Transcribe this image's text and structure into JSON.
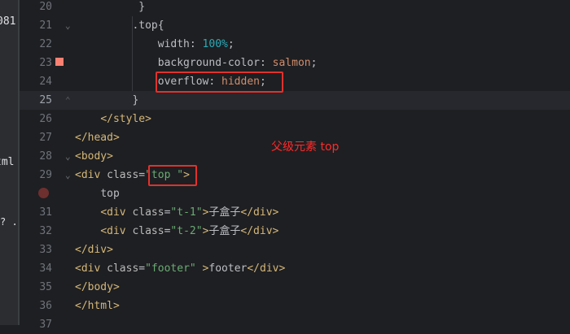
{
  "left_panel": {
    "fragments": [
      "081",
      "tml",
      "? .h"
    ]
  },
  "line_numbers": [
    "20",
    "21",
    "22",
    "23",
    "24",
    "25",
    "26",
    "27",
    "28",
    "29",
    "30",
    "31",
    "32",
    "33",
    "34",
    "35",
    "36",
    "37"
  ],
  "code": {
    "l20": {
      "brace": "}"
    },
    "l21": {
      "selector": ".top",
      "brace": "{"
    },
    "l22": {
      "prop": "width",
      "colon": ": ",
      "num": "100%",
      "semi": ";"
    },
    "l23": {
      "prop": "background-color",
      "colon": ": ",
      "val": "salmon",
      "semi": ";"
    },
    "l24": {
      "prop": "overflow",
      "colon": ": ",
      "val": "hidden",
      "semi": ";"
    },
    "l25": {
      "brace": "}"
    },
    "l26": {
      "tag": "</style>"
    },
    "l27": {
      "tag": "</head>"
    },
    "l28": {
      "tag": "<body>"
    },
    "l29": {
      "tag_open": "<div ",
      "attr": "class",
      "eq": "=",
      "str": "\"top \"",
      "tag_close": ">"
    },
    "l30": {
      "text": "top"
    },
    "l31": {
      "tag_open": "<div ",
      "attr": "class",
      "eq": "=",
      "str": "\"t-1\"",
      "tag_mid": ">",
      "text": "子盒子",
      "tag_close": "</div>"
    },
    "l32": {
      "tag_open": "<div ",
      "attr": "class",
      "eq": "=",
      "str": "\"t-2\"",
      "tag_mid": ">",
      "text": "子盒子",
      "tag_close": "</div>"
    },
    "l33": {
      "tag": "</div>"
    },
    "l34": {
      "tag_open": "<div ",
      "attr": "class",
      "eq": "=",
      "str": "\"footer\"",
      "tag_mid": " >",
      "text": "footer",
      "tag_close": "</div>"
    },
    "l35": {
      "tag": "</body>"
    },
    "l36": {
      "tag": "</html>"
    }
  },
  "annotation": "父级元素 top",
  "colors": {
    "swatch": "#fa8072",
    "highlight_box": "#e0322d",
    "annotation": "#ff2a2a"
  }
}
